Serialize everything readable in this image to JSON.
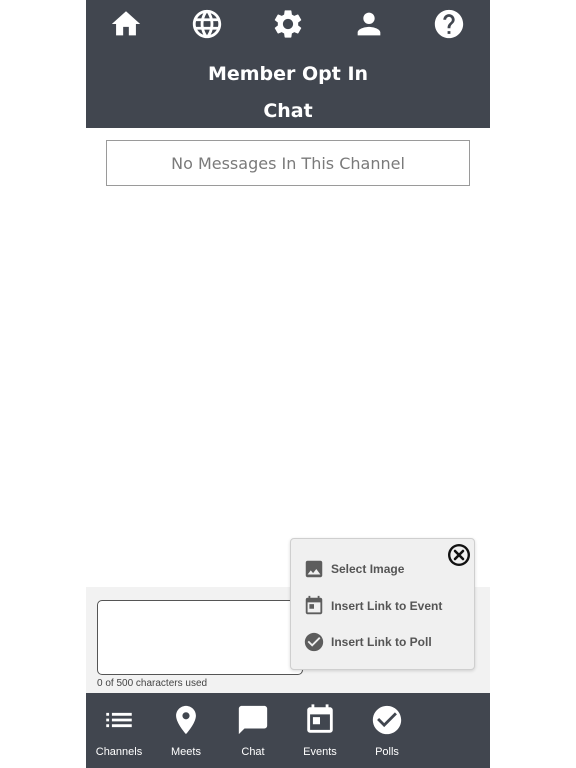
{
  "header": {
    "title": "Member Opt In",
    "subtitle": "Chat",
    "icons": [
      "home-icon",
      "globe-icon",
      "gear-icon",
      "person-icon",
      "help-icon"
    ]
  },
  "messages": {
    "empty_text": "No Messages In This Channel"
  },
  "composer": {
    "value": "",
    "char_count": "0 of 500 characters used"
  },
  "attach_menu": {
    "items": [
      {
        "label": "Select Image",
        "icon": "image-icon"
      },
      {
        "label": "Insert Link to Event",
        "icon": "calendar-icon"
      },
      {
        "label": "Insert Link to Poll",
        "icon": "check-circle-icon"
      }
    ],
    "close_icon": "close-circle-icon"
  },
  "bottom_nav": {
    "items": [
      {
        "label": "Channels",
        "icon": "list-icon"
      },
      {
        "label": "Meets",
        "icon": "location-pin-icon"
      },
      {
        "label": "Chat",
        "icon": "chat-bubble-icon"
      },
      {
        "label": "Events",
        "icon": "calendar-icon"
      },
      {
        "label": "Polls",
        "icon": "check-circle-icon"
      }
    ]
  },
  "colors": {
    "bar_bg": "#41464f",
    "popup_bg": "#f0f0f0",
    "composer_bg": "#f2f2f2"
  }
}
